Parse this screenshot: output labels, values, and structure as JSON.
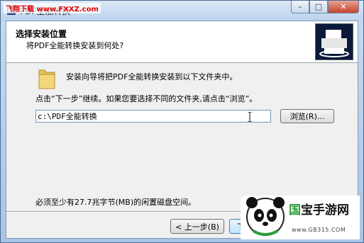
{
  "window": {
    "title": "PDF全能转换",
    "watermark_tl": "飞翔下载 www.FXXZ.com",
    "controls": {
      "minimize": "–",
      "maximize": "□",
      "close": "✕"
    }
  },
  "header": {
    "title": "选择安装位置",
    "subtitle": "将PDF全能转换安装到何处?"
  },
  "body": {
    "info": "安装向导将把PDF全能转换安装到以下文件夹中。",
    "instruction": "点击“下一步”继续。如果您要选择不同的文件夹,请点击“浏览”。",
    "path_value": "c:\\PDF全能转换",
    "browse_label": "浏览(R)...",
    "space_note": "必须至少有27.7兆字节(MB)的闲置磁盘空间。"
  },
  "footer": {
    "back_label": "< 上一步(B)",
    "next_label": "下"
  },
  "badge": {
    "brand_1": "国",
    "brand_2": "宝手游网",
    "url": "www.GB315.COM"
  },
  "icons": {
    "app": "app-icon",
    "folder": "folder-icon",
    "logo": "printer-logo-icon",
    "cursor": "text-cursor-icon"
  }
}
